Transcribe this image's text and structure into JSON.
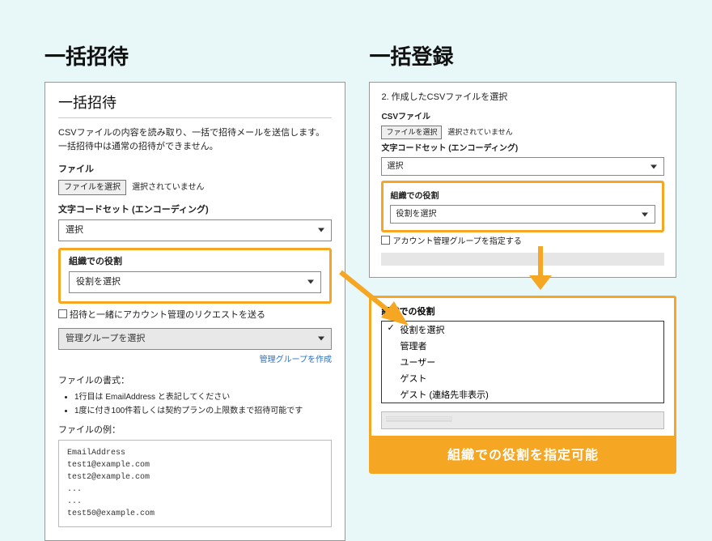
{
  "colors": {
    "accent": "#f5a623"
  },
  "headers": {
    "left": "一括招待",
    "right": "一括登録"
  },
  "left_panel": {
    "title": "一括招待",
    "desc": "CSVファイルの内容を読み取り、一括で招待メールを送信します。一括招待中は通常の招待ができません。",
    "file_label": "ファイル",
    "file_button": "ファイルを選択",
    "file_status": "選択されていません",
    "encoding_label": "文字コードセット (エンコーディング)",
    "encoding_value": "選択",
    "role_label": "組織での役割",
    "role_value": "役割を選択",
    "checkbox_label": "招待と一緒にアカウント管理のリクエストを送る",
    "group_select": "管理グループを選択",
    "create_group_link": "管理グループを作成",
    "format_label": "ファイルの書式：",
    "format_bullets": [
      "1行目は EmailAddress と表記してください",
      "1度に付き100件若しくは契約プランの上限数まで招待可能です"
    ],
    "example_label": "ファイルの例：",
    "example_text": "EmailAddress\ntest1@example.com\ntest2@example.com\n...\n...\ntest50@example.com"
  },
  "right_panel": {
    "step_title": "2. 作成したCSVファイルを選択",
    "csv_label": "CSVファイル",
    "file_button": "ファイルを選択",
    "file_status": "選択されていません",
    "encoding_label": "文字コードセット (エンコーディング)",
    "encoding_value": "選択",
    "role_label": "組織での役割",
    "role_value": "役割を選択",
    "checkbox_label": "アカウント管理グループを指定する"
  },
  "dropdown": {
    "label": "組織での役割",
    "options": [
      "役割を選択",
      "管理者",
      "ユーザー",
      "ゲスト",
      "ゲスト (連絡先非表示)"
    ],
    "selected_index": 0
  },
  "caption": "組織での役割を指定可能"
}
